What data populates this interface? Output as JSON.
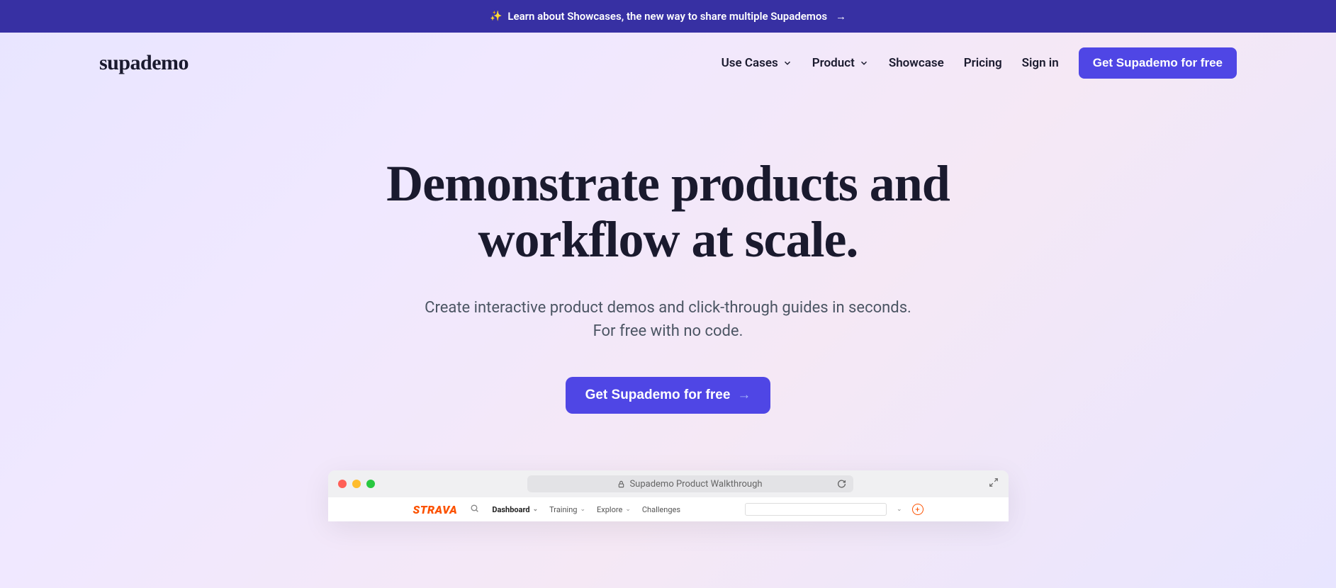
{
  "banner": {
    "text": "Learn about Showcases, the new way to share multiple Supademos"
  },
  "brand": {
    "name": "supademo"
  },
  "nav": {
    "use_cases": "Use Cases",
    "product": "Product",
    "showcase": "Showcase",
    "pricing": "Pricing",
    "sign_in": "Sign in",
    "cta": "Get Supademo for free"
  },
  "hero": {
    "title_line1": "Demonstrate products and",
    "title_line2": "workflow at scale.",
    "sub_line1": "Create interactive product demos and click-through guides in seconds.",
    "sub_line2": "For free with no code.",
    "cta": "Get Supademo for free"
  },
  "mockup": {
    "address": "Supademo Product Walkthrough",
    "app_logo": "STRAVA",
    "nav": {
      "dashboard": "Dashboard",
      "training": "Training",
      "explore": "Explore",
      "challenges": "Challenges"
    }
  }
}
